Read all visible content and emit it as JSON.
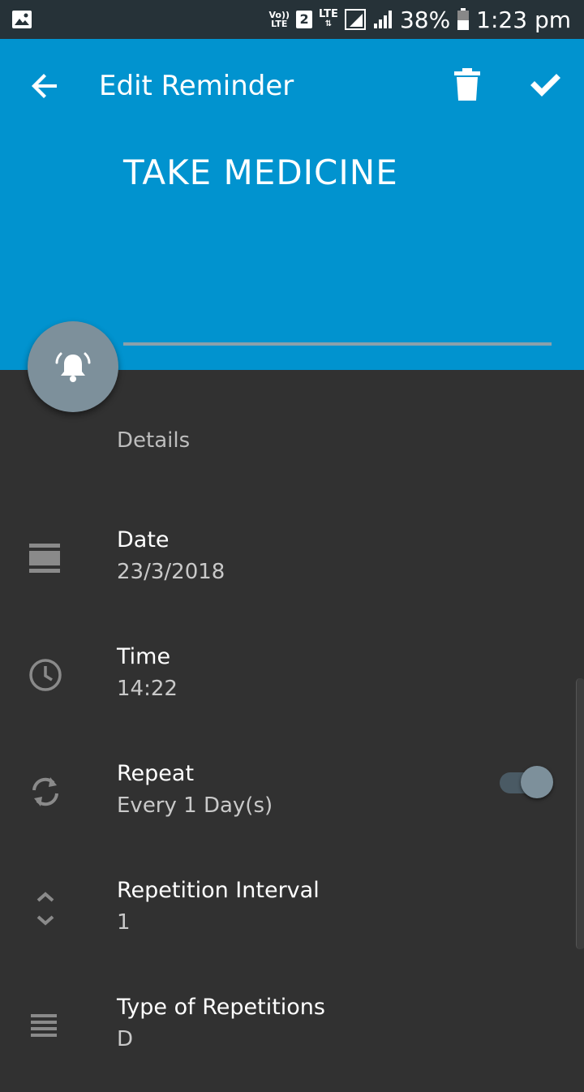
{
  "status_bar": {
    "volte_top": "Vo))",
    "volte_bottom": "LTE",
    "sim": "2",
    "lte": "LTE",
    "battery": "38%",
    "time": "1:23 pm"
  },
  "header": {
    "title": "Edit Reminder",
    "reminder_text": "TAKE MEDICINE",
    "color": "#0193cf"
  },
  "details": {
    "section_label": "Details",
    "rows": [
      {
        "label": "Date",
        "value": "23/3/2018",
        "icon": "calendar-icon"
      },
      {
        "label": "Time",
        "value": "14:22",
        "icon": "clock-icon"
      },
      {
        "label": "Repeat",
        "value": "Every 1 Day(s)",
        "icon": "repeat-icon",
        "toggle_on": true
      },
      {
        "label": "Repetition Interval",
        "value": "1",
        "icon": "unfold-icon"
      },
      {
        "label": "Type of Repetitions",
        "value": "D",
        "icon": "list-icon"
      }
    ]
  }
}
